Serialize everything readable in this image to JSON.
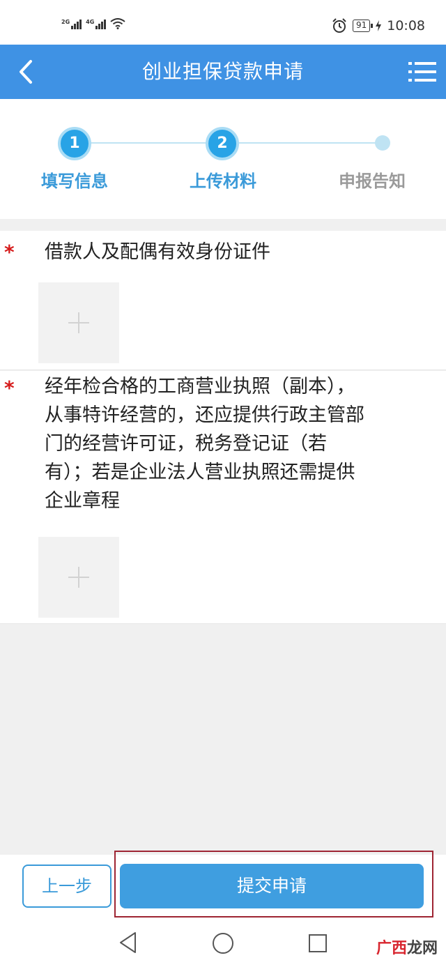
{
  "status_bar": {
    "network_1": "2G",
    "network_2": "4G",
    "battery_level": "91",
    "time": "10:08"
  },
  "header": {
    "title": "创业担保贷款申请",
    "back_icon": "chevron-left-icon",
    "menu_icon": "menu-icon"
  },
  "steps": [
    {
      "number": "1",
      "label": "填写信息",
      "state": "done"
    },
    {
      "number": "2",
      "label": "上传材料",
      "state": "active"
    },
    {
      "number": "",
      "label": "申报告知",
      "state": "pending"
    }
  ],
  "materials": [
    {
      "required_mark": "*",
      "lines": [
        "借款人及配偶有效身份证件"
      ]
    },
    {
      "required_mark": "*",
      "lines": [
        "经年检合格的工商营业执照（副本），",
        "从事特许经营的，还应提供行政主管部",
        "门的经营许可证，税务登记证（若",
        "有）；若是企业法人营业执照还需提供",
        "企业章程"
      ]
    }
  ],
  "actions": {
    "prev_label": "上一步",
    "submit_label": "提交申请"
  },
  "watermark": {
    "part1": "广西",
    "part2": "龙网"
  },
  "colors": {
    "brand": "#3f92e4",
    "step_active": "#28a3e6",
    "required": "#d61c1c",
    "highlight": "#9e2432"
  }
}
